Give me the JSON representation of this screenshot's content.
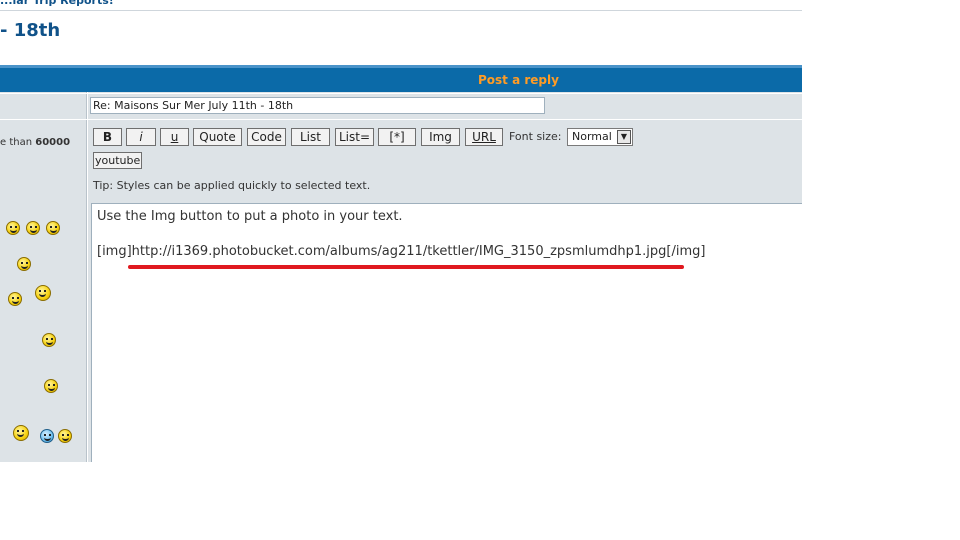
{
  "breadcrumb": "...lar Trip Reports!",
  "topic_title": "- 18th",
  "panel_title": "Post a reply",
  "subject_value": "Re: Maisons Sur Mer July 11th - 18th",
  "side_note": {
    "prefix": "e than",
    "number": "60000"
  },
  "toolbar": {
    "bold": "B",
    "italic": "i",
    "underline": "u",
    "quote": "Quote",
    "code": "Code",
    "list": "List",
    "list_eq": "List=",
    "list_item": "[*]",
    "img": "Img",
    "url": "URL",
    "font_size_label": "Font size:",
    "font_size_value": "Normal",
    "youtube": "youtube"
  },
  "tip": "Tip: Styles can be applied quickly to selected text.",
  "message": {
    "line1": "Use the Img button to put a photo in your text.",
    "open_tag": "[img]",
    "url": "http://i1369.photobucket.com/albums/ag211/tkettler/IMG_3150_zpsmlumdhp1.jpg",
    "close_tag": "[/img]"
  },
  "colors": {
    "header_bg": "#0b6aa8",
    "header_text": "#ff9c25",
    "title_blue": "#105289",
    "highlight_red": "#e0191f",
    "panel_bg": "#dde3e7"
  },
  "smilies": [
    "smile-icon",
    "wink-icon",
    "cool-icon",
    "angel-icon",
    "sad-icon",
    "laugh-icon"
  ]
}
